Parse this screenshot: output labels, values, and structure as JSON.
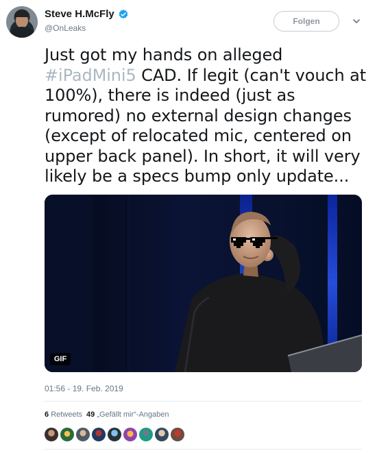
{
  "author": {
    "display_name": "Steve H.McFly",
    "handle": "@OnLeaks",
    "verified": true
  },
  "actions": {
    "follow_label": "Folgen",
    "more_menu_icon": "chevron-down-icon"
  },
  "tweet": {
    "text_before_hashtag": "Just got my hands on alleged ",
    "hashtag": "#iPadMini5",
    "text_after_hashtag": " CAD. If legit (can't vouch at 100%), there is indeed (just as rumored) no external design changes (except of relocated mic, centered on upper back panel). In short, it will very likely be a specs bump only update...",
    "media_badge": "GIF",
    "timestamp": "01:56 - 19. Feb. 2019"
  },
  "stats": {
    "retweets_count": "6",
    "retweets_label": "Retweets",
    "likes_count": "49",
    "likes_label": "„Gefällt mir“-Angaben"
  },
  "colors": {
    "hashtag": "#aab8c2",
    "verified_badge": "#1da1f2",
    "secondary_text": "#657786"
  },
  "liker_avatar_count": 9
}
